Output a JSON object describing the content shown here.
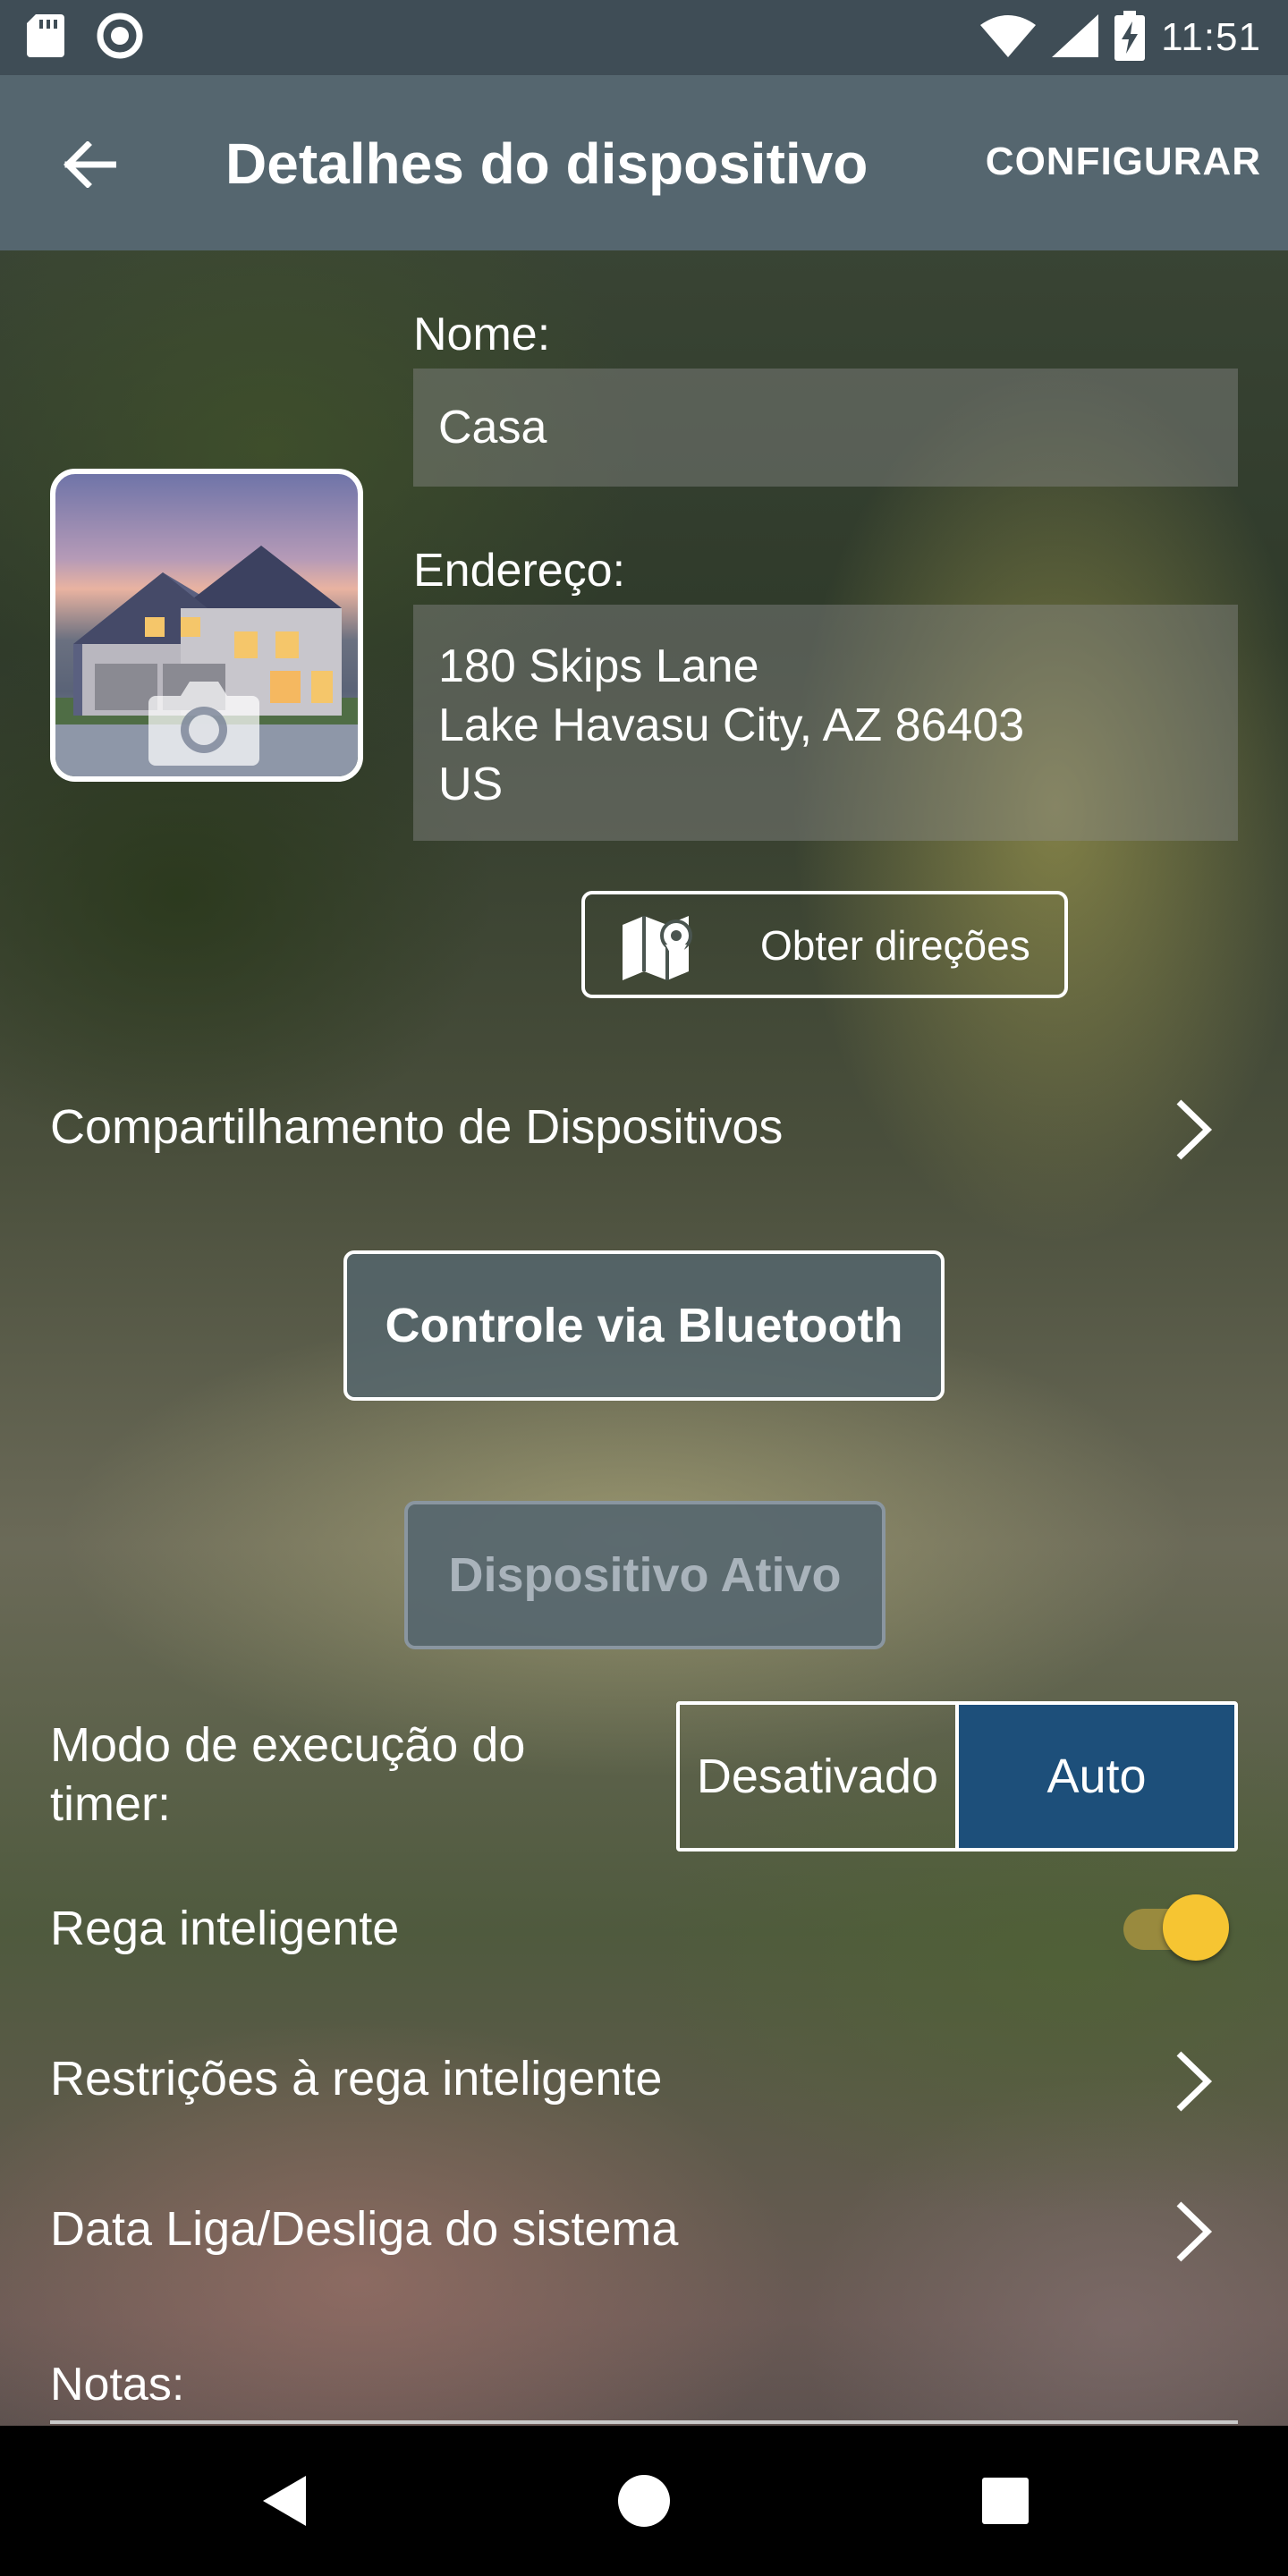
{
  "status_bar": {
    "time": "11:51",
    "icons": [
      "sd-card-icon",
      "sync-icon",
      "wifi-icon",
      "signal-icon",
      "battery-charging-icon"
    ]
  },
  "app_bar": {
    "title": "Detalhes do dispositivo",
    "action": "CONFIGURAR",
    "back_icon": "arrow-left-icon"
  },
  "device": {
    "photo_icon": "camera-icon",
    "name_label": "Nome:",
    "name_value": "Casa",
    "address_label": "Endereço:",
    "address_lines": [
      "180 Skips Lane",
      "Lake Havasu City, AZ 86403",
      "US"
    ],
    "directions_label": "Obter direções",
    "directions_icon": "map-pin-icon"
  },
  "rows": {
    "sharing": "Compartilhamento de Dispositivos",
    "bluetooth_button": "Controle via Bluetooth",
    "active_button": "Dispositivo Ativo",
    "timer_mode_label": "Modo de execução do timer:",
    "timer_mode_options": [
      "Desativado",
      "Auto"
    ],
    "timer_mode_selected": "Auto",
    "smart_watering": "Rega inteligente",
    "smart_watering_on": true,
    "smart_restrictions": "Restrições à rega inteligente",
    "system_onoff_date": "Data Liga/Desliga do sistema",
    "notes_label": "Notas:"
  },
  "colors": {
    "status_bar": "#3f4d56",
    "app_bar": "#55666f",
    "segment_selected": "#1d4f7a",
    "toggle_thumb": "#f6c532"
  }
}
